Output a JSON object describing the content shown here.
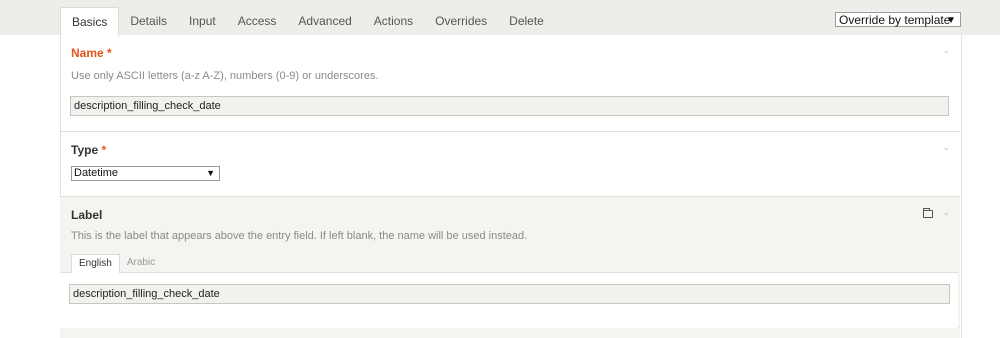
{
  "tabs": [
    "Basics",
    "Details",
    "Input",
    "Access",
    "Advanced",
    "Actions",
    "Overrides",
    "Delete"
  ],
  "override_select": {
    "value": "Override by template",
    "arrow": "▼"
  },
  "name_field": {
    "title": "Name",
    "required_mark": "*",
    "help": "Use only ASCII letters (a-z A-Z), numbers (0-9) or underscores.",
    "value": "description_filling_check_date",
    "collapse_icon": "⌄"
  },
  "type_field": {
    "title": "Type",
    "required_mark": "*",
    "value": "Datetime",
    "arrow": "▼",
    "collapse_icon": "⌄"
  },
  "label_field": {
    "title": "Label",
    "help": "This is the label that appears above the entry field. If left blank, the name will be used instead.",
    "languages": [
      "English",
      "Arabic"
    ],
    "value": "description_filling_check_date",
    "collapse_icon": "⌄",
    "folder_icon": "folder-icon"
  }
}
